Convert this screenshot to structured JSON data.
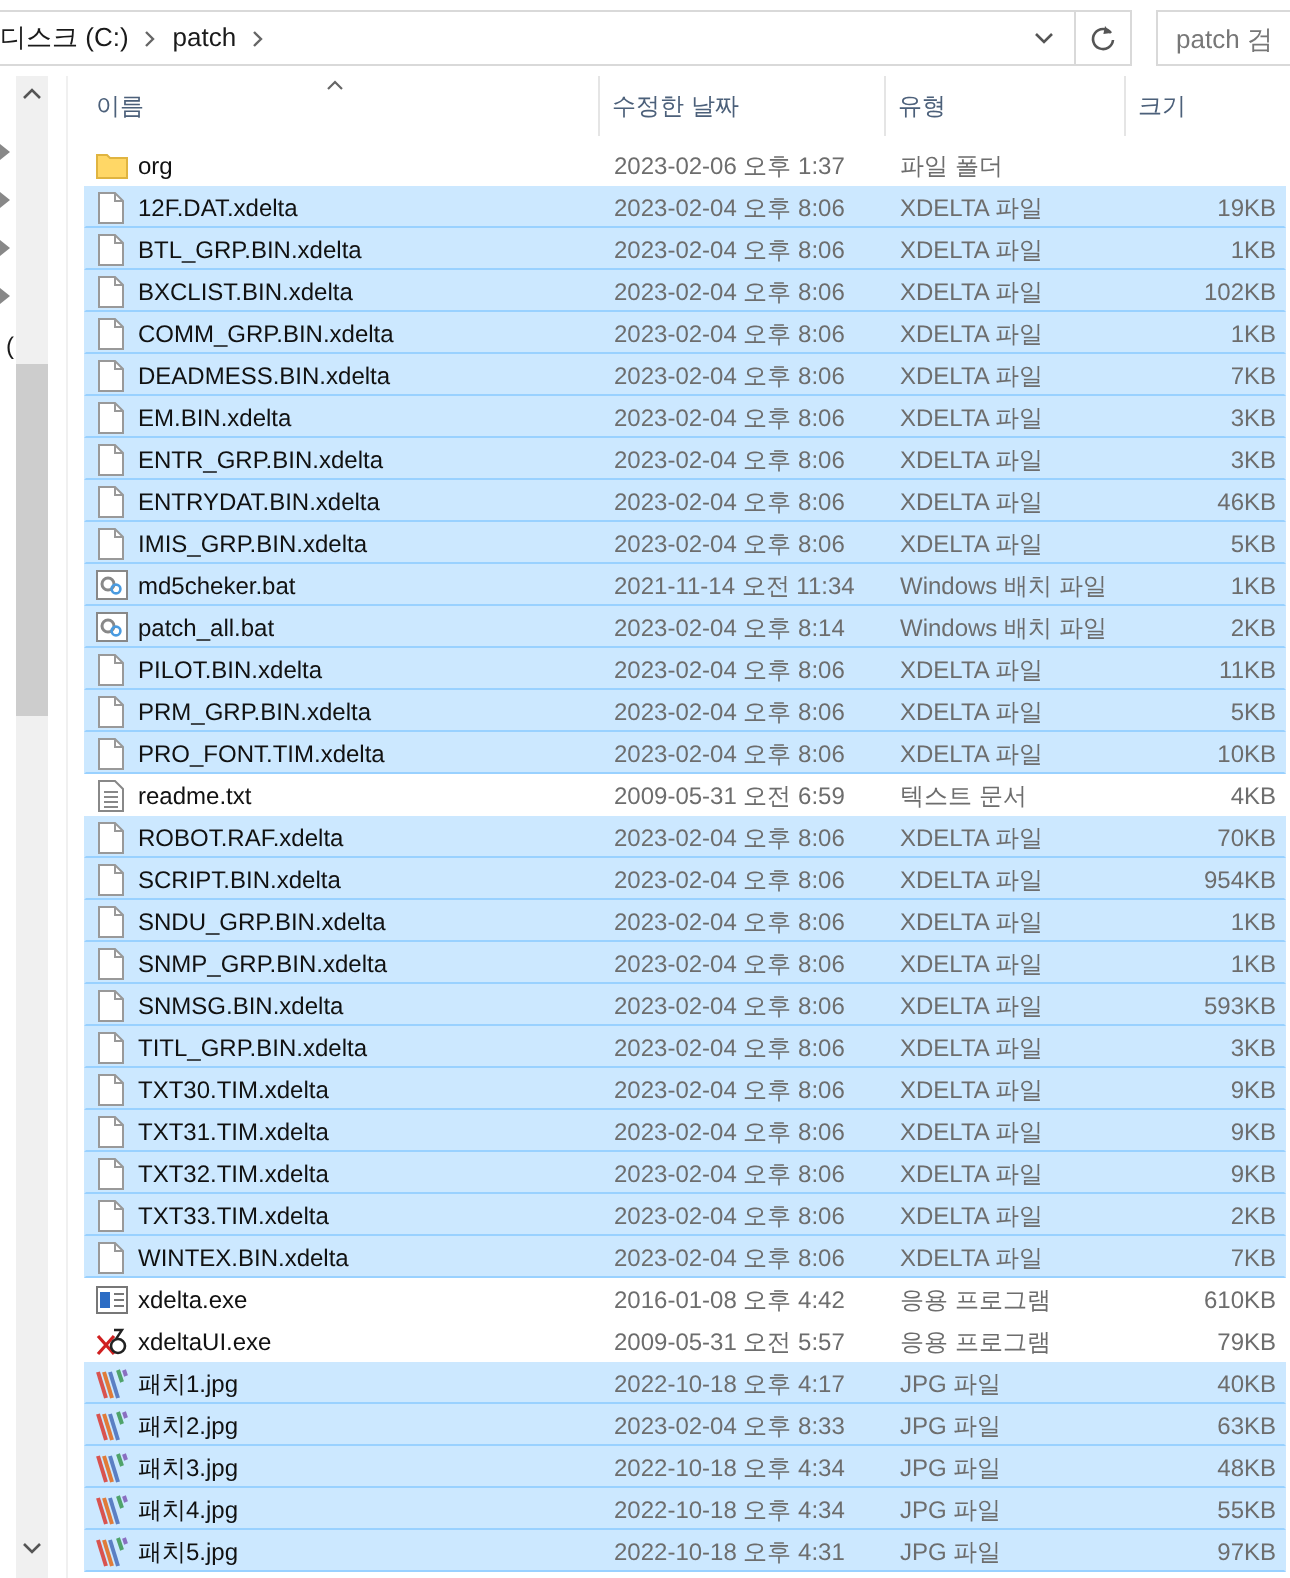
{
  "address_bar": {
    "breadcrumbs": [
      "디스크 (C:)",
      "patch"
    ]
  },
  "search": {
    "placeholder": "patch 검"
  },
  "nav_pane": {
    "label": "("
  },
  "columns": [
    {
      "label": "이름",
      "sorted": true
    },
    {
      "label": "수정한 날짜",
      "sorted": false
    },
    {
      "label": "유형",
      "sorted": false
    },
    {
      "label": "크기",
      "sorted": false
    }
  ],
  "rows": [
    {
      "kind": "folder",
      "name": "org",
      "date": "2023-02-06 오후 1:37",
      "type": "파일 폴더",
      "selected": false
    },
    {
      "kind": "file",
      "name": "12F.DAT.xdelta",
      "date": "2023-02-04 오후 8:06",
      "type": "XDELTA 파일",
      "size": "19KB",
      "selected": true
    },
    {
      "kind": "file",
      "name": "BTL_GRP.BIN.xdelta",
      "date": "2023-02-04 오후 8:06",
      "type": "XDELTA 파일",
      "size": "1KB",
      "selected": true
    },
    {
      "kind": "file",
      "name": "BXCLIST.BIN.xdelta",
      "date": "2023-02-04 오후 8:06",
      "type": "XDELTA 파일",
      "size": "102KB",
      "selected": true
    },
    {
      "kind": "file",
      "name": "COMM_GRP.BIN.xdelta",
      "date": "2023-02-04 오후 8:06",
      "type": "XDELTA 파일",
      "size": "1KB",
      "selected": true
    },
    {
      "kind": "file",
      "name": "DEADMESS.BIN.xdelta",
      "date": "2023-02-04 오후 8:06",
      "type": "XDELTA 파일",
      "size": "7KB",
      "selected": true
    },
    {
      "kind": "file",
      "name": "EM.BIN.xdelta",
      "date": "2023-02-04 오후 8:06",
      "type": "XDELTA 파일",
      "size": "3KB",
      "selected": true
    },
    {
      "kind": "file",
      "name": "ENTR_GRP.BIN.xdelta",
      "date": "2023-02-04 오후 8:06",
      "type": "XDELTA 파일",
      "size": "3KB",
      "selected": true
    },
    {
      "kind": "file",
      "name": "ENTRYDAT.BIN.xdelta",
      "date": "2023-02-04 오후 8:06",
      "type": "XDELTA 파일",
      "size": "46KB",
      "selected": true
    },
    {
      "kind": "file",
      "name": "IMIS_GRP.BIN.xdelta",
      "date": "2023-02-04 오후 8:06",
      "type": "XDELTA 파일",
      "size": "5KB",
      "selected": true
    },
    {
      "kind": "batch",
      "name": "md5cheker.bat",
      "date": "2021-11-14 오전 11:34",
      "type": "Windows 배치 파일",
      "size": "1KB",
      "selected": true
    },
    {
      "kind": "batch",
      "name": "patch_all.bat",
      "date": "2023-02-04 오후 8:14",
      "type": "Windows 배치 파일",
      "size": "2KB",
      "selected": true
    },
    {
      "kind": "file",
      "name": "PILOT.BIN.xdelta",
      "date": "2023-02-04 오후 8:06",
      "type": "XDELTA 파일",
      "size": "11KB",
      "selected": true
    },
    {
      "kind": "file",
      "name": "PRM_GRP.BIN.xdelta",
      "date": "2023-02-04 오후 8:06",
      "type": "XDELTA 파일",
      "size": "5KB",
      "selected": true
    },
    {
      "kind": "file",
      "name": "PRO_FONT.TIM.xdelta",
      "date": "2023-02-04 오후 8:06",
      "type": "XDELTA 파일",
      "size": "10KB",
      "selected": true
    },
    {
      "kind": "text",
      "name": "readme.txt",
      "date": "2009-05-31 오전 6:59",
      "type": "텍스트 문서",
      "size": "4KB",
      "selected": false
    },
    {
      "kind": "file",
      "name": "ROBOT.RAF.xdelta",
      "date": "2023-02-04 오후 8:06",
      "type": "XDELTA 파일",
      "size": "70KB",
      "selected": true
    },
    {
      "kind": "file",
      "name": "SCRIPT.BIN.xdelta",
      "date": "2023-02-04 오후 8:06",
      "type": "XDELTA 파일",
      "size": "954KB",
      "selected": true
    },
    {
      "kind": "file",
      "name": "SNDU_GRP.BIN.xdelta",
      "date": "2023-02-04 오후 8:06",
      "type": "XDELTA 파일",
      "size": "1KB",
      "selected": true
    },
    {
      "kind": "file",
      "name": "SNMP_GRP.BIN.xdelta",
      "date": "2023-02-04 오후 8:06",
      "type": "XDELTA 파일",
      "size": "1KB",
      "selected": true
    },
    {
      "kind": "file",
      "name": "SNMSG.BIN.xdelta",
      "date": "2023-02-04 오후 8:06",
      "type": "XDELTA 파일",
      "size": "593KB",
      "selected": true
    },
    {
      "kind": "file",
      "name": "TITL_GRP.BIN.xdelta",
      "date": "2023-02-04 오후 8:06",
      "type": "XDELTA 파일",
      "size": "3KB",
      "selected": true
    },
    {
      "kind": "file",
      "name": "TXT30.TIM.xdelta",
      "date": "2023-02-04 오후 8:06",
      "type": "XDELTA 파일",
      "size": "9KB",
      "selected": true
    },
    {
      "kind": "file",
      "name": "TXT31.TIM.xdelta",
      "date": "2023-02-04 오후 8:06",
      "type": "XDELTA 파일",
      "size": "9KB",
      "selected": true
    },
    {
      "kind": "file",
      "name": "TXT32.TIM.xdelta",
      "date": "2023-02-04 오후 8:06",
      "type": "XDELTA 파일",
      "size": "9KB",
      "selected": true
    },
    {
      "kind": "file",
      "name": "TXT33.TIM.xdelta",
      "date": "2023-02-04 오후 8:06",
      "type": "XDELTA 파일",
      "size": "2KB",
      "selected": true
    },
    {
      "kind": "file",
      "name": "WINTEX.BIN.xdelta",
      "date": "2023-02-04 오후 8:06",
      "type": "XDELTA 파일",
      "size": "7KB",
      "selected": true
    },
    {
      "kind": "program",
      "name": "xdelta.exe",
      "date": "2016-01-08 오후 4:42",
      "type": "응용 프로그램",
      "size": "610KB",
      "selected": false
    },
    {
      "kind": "tool",
      "name": "xdeltaUI.exe",
      "date": "2009-05-31 오전 5:57",
      "type": "응용 프로그램",
      "size": "79KB",
      "selected": false
    },
    {
      "kind": "image",
      "name": "패치1.jpg",
      "date": "2022-10-18 오후 4:17",
      "type": "JPG 파일",
      "size": "40KB",
      "selected": true
    },
    {
      "kind": "image",
      "name": "패치2.jpg",
      "date": "2023-02-04 오후 8:33",
      "type": "JPG 파일",
      "size": "63KB",
      "selected": true
    },
    {
      "kind": "image",
      "name": "패치3.jpg",
      "date": "2022-10-18 오후 4:34",
      "type": "JPG 파일",
      "size": "48KB",
      "selected": true
    },
    {
      "kind": "image",
      "name": "패치4.jpg",
      "date": "2022-10-18 오후 4:34",
      "type": "JPG 파일",
      "size": "55KB",
      "selected": true
    },
    {
      "kind": "image",
      "name": "패치5.jpg",
      "date": "2022-10-18 오후 4:31",
      "type": "JPG 파일",
      "size": "97KB",
      "selected": true
    }
  ]
}
